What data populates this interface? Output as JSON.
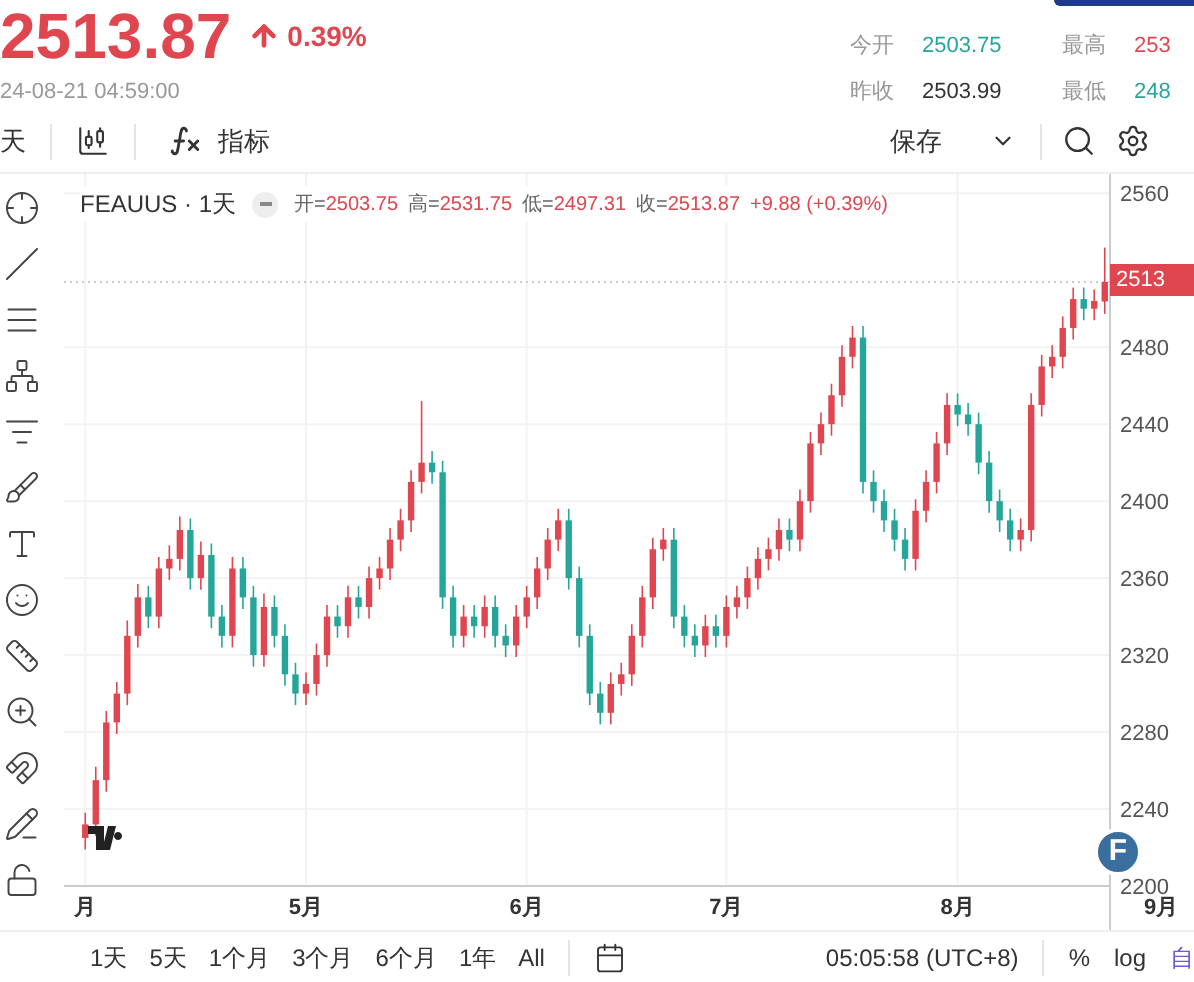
{
  "quote": {
    "price": "2513.87",
    "change": "0.39%",
    "timestamp": "24-08-21 04:59:00"
  },
  "stats": [
    {
      "label": "今开",
      "value": "2503.75",
      "color": "#26a69a"
    },
    {
      "label": "昨收",
      "value": "2503.99",
      "color": "#333333"
    },
    {
      "label": "最高",
      "value": "253",
      "color": "#e0464f"
    },
    {
      "label": "最低",
      "value": "248",
      "color": "#26a69a"
    }
  ],
  "toolbar": {
    "interval": "天",
    "indicators": "指标",
    "save": "保存"
  },
  "legend": {
    "symbol": "FEAUUS · 1天",
    "values": [
      {
        "label": "开=",
        "value": "2503.75"
      },
      {
        "label": "高=",
        "value": "2531.75"
      },
      {
        "label": "低=",
        "value": "2497.31"
      },
      {
        "label": "收=",
        "value": "2513.87"
      }
    ],
    "change": "+9.88 (+0.39%)"
  },
  "chart_data": {
    "type": "candlestick",
    "categories": [
      "月",
      null,
      null,
      null,
      null,
      null,
      null,
      null,
      null,
      null,
      null,
      null,
      null,
      null,
      null,
      null,
      null,
      null,
      null,
      null,
      null,
      "5月",
      null,
      null,
      null,
      null,
      null,
      null,
      null,
      null,
      null,
      null,
      null,
      null,
      null,
      null,
      null,
      null,
      null,
      null,
      null,
      null,
      "6月",
      null,
      null,
      null,
      null,
      null,
      null,
      null,
      null,
      null,
      null,
      null,
      null,
      null,
      null,
      null,
      null,
      null,
      null,
      "7月",
      null,
      null,
      null,
      null,
      null,
      null,
      null,
      null,
      null,
      null,
      null,
      null,
      null,
      null,
      null,
      null,
      null,
      null,
      null,
      null,
      null,
      "8月",
      null,
      null,
      null,
      null,
      null,
      null,
      null,
      null,
      null,
      null,
      null,
      null,
      null,
      null
    ],
    "ohlc": [
      [
        2225,
        2238,
        2219,
        2232
      ],
      [
        2232,
        2262,
        2226,
        2255
      ],
      [
        2255,
        2291,
        2249,
        2285
      ],
      [
        2285,
        2306,
        2279,
        2300
      ],
      [
        2300,
        2338,
        2294,
        2330
      ],
      [
        2330,
        2357,
        2324,
        2350
      ],
      [
        2350,
        2356,
        2334,
        2340
      ],
      [
        2340,
        2371,
        2334,
        2365
      ],
      [
        2365,
        2377,
        2359,
        2370
      ],
      [
        2370,
        2392,
        2364,
        2385
      ],
      [
        2385,
        2391,
        2354,
        2360
      ],
      [
        2360,
        2379,
        2354,
        2372
      ],
      [
        2372,
        2378,
        2334,
        2340
      ],
      [
        2340,
        2346,
        2324,
        2330
      ],
      [
        2330,
        2371,
        2324,
        2365
      ],
      [
        2365,
        2371,
        2344,
        2350
      ],
      [
        2350,
        2356,
        2314,
        2320
      ],
      [
        2320,
        2352,
        2314,
        2345
      ],
      [
        2345,
        2351,
        2324,
        2330
      ],
      [
        2330,
        2336,
        2304,
        2310
      ],
      [
        2310,
        2316,
        2294,
        2300
      ],
      [
        2300,
        2311,
        2294,
        2305
      ],
      [
        2305,
        2326,
        2299,
        2320
      ],
      [
        2320,
        2346,
        2314,
        2340
      ],
      [
        2340,
        2346,
        2329,
        2335
      ],
      [
        2335,
        2356,
        2329,
        2350
      ],
      [
        2350,
        2356,
        2339,
        2345
      ],
      [
        2345,
        2366,
        2339,
        2360
      ],
      [
        2360,
        2371,
        2354,
        2365
      ],
      [
        2365,
        2386,
        2359,
        2380
      ],
      [
        2380,
        2396,
        2374,
        2390
      ],
      [
        2390,
        2416,
        2384,
        2410
      ],
      [
        2410,
        2452,
        2404,
        2420
      ],
      [
        2420,
        2426,
        2409,
        2415
      ],
      [
        2415,
        2421,
        2344,
        2350
      ],
      [
        2350,
        2356,
        2324,
        2330
      ],
      [
        2330,
        2346,
        2324,
        2340
      ],
      [
        2340,
        2346,
        2329,
        2335
      ],
      [
        2335,
        2351,
        2329,
        2345
      ],
      [
        2345,
        2351,
        2324,
        2330
      ],
      [
        2330,
        2336,
        2319,
        2325
      ],
      [
        2325,
        2346,
        2319,
        2340
      ],
      [
        2340,
        2356,
        2334,
        2350
      ],
      [
        2350,
        2371,
        2344,
        2365
      ],
      [
        2365,
        2386,
        2359,
        2380
      ],
      [
        2380,
        2396,
        2374,
        2390
      ],
      [
        2390,
        2396,
        2354,
        2360
      ],
      [
        2360,
        2366,
        2324,
        2330
      ],
      [
        2330,
        2336,
        2294,
        2300
      ],
      [
        2300,
        2306,
        2284,
        2290
      ],
      [
        2290,
        2311,
        2284,
        2305
      ],
      [
        2305,
        2316,
        2299,
        2310
      ],
      [
        2310,
        2336,
        2304,
        2330
      ],
      [
        2330,
        2356,
        2324,
        2350
      ],
      [
        2350,
        2381,
        2344,
        2375
      ],
      [
        2375,
        2386,
        2369,
        2380
      ],
      [
        2380,
        2386,
        2334,
        2340
      ],
      [
        2340,
        2346,
        2324,
        2330
      ],
      [
        2330,
        2336,
        2319,
        2325
      ],
      [
        2325,
        2341,
        2319,
        2335
      ],
      [
        2335,
        2341,
        2324,
        2330
      ],
      [
        2330,
        2351,
        2324,
        2345
      ],
      [
        2345,
        2356,
        2339,
        2350
      ],
      [
        2350,
        2366,
        2344,
        2360
      ],
      [
        2360,
        2376,
        2354,
        2370
      ],
      [
        2370,
        2381,
        2364,
        2375
      ],
      [
        2375,
        2391,
        2369,
        2385
      ],
      [
        2385,
        2391,
        2374,
        2380
      ],
      [
        2380,
        2406,
        2374,
        2400
      ],
      [
        2400,
        2436,
        2394,
        2430
      ],
      [
        2430,
        2446,
        2424,
        2440
      ],
      [
        2440,
        2461,
        2434,
        2455
      ],
      [
        2455,
        2481,
        2449,
        2475
      ],
      [
        2475,
        2491,
        2469,
        2485
      ],
      [
        2485,
        2491,
        2404,
        2410
      ],
      [
        2410,
        2416,
        2394,
        2400
      ],
      [
        2400,
        2406,
        2384,
        2390
      ],
      [
        2390,
        2396,
        2374,
        2380
      ],
      [
        2380,
        2386,
        2364,
        2370
      ],
      [
        2370,
        2401,
        2364,
        2395
      ],
      [
        2395,
        2416,
        2389,
        2410
      ],
      [
        2410,
        2436,
        2404,
        2430
      ],
      [
        2430,
        2456,
        2424,
        2450
      ],
      [
        2450,
        2456,
        2439,
        2445
      ],
      [
        2445,
        2451,
        2434,
        2440
      ],
      [
        2440,
        2446,
        2414,
        2420
      ],
      [
        2420,
        2426,
        2394,
        2400
      ],
      [
        2400,
        2406,
        2384,
        2390
      ],
      [
        2390,
        2396,
        2374,
        2380
      ],
      [
        2380,
        2391,
        2374,
        2385
      ],
      [
        2385,
        2456,
        2379,
        2450
      ],
      [
        2450,
        2476,
        2444,
        2470
      ],
      [
        2470,
        2481,
        2464,
        2475
      ],
      [
        2475,
        2496,
        2469,
        2490
      ],
      [
        2490,
        2511,
        2484,
        2505
      ],
      [
        2505,
        2511,
        2494,
        2500
      ],
      [
        2500,
        2510,
        2494,
        2504
      ],
      [
        2503.75,
        2531.75,
        2497.31,
        2513.87
      ]
    ],
    "ylim": [
      2200,
      2570
    ],
    "yticks": [
      2560,
      2480,
      2440,
      2400,
      2360,
      2320,
      2280,
      2240,
      2200
    ],
    "grid": true,
    "ref_lines": [
      {
        "axis": "y",
        "value": 2513.87
      }
    ]
  },
  "time_axis_end": "9月",
  "current_price": "2513",
  "badge": "F",
  "ranges": [
    "1天",
    "5天",
    "1个月",
    "3个月",
    "6个月",
    "1年",
    "All"
  ],
  "clock": "05:05:58 (UTC+8)",
  "scale_buttons": [
    "%",
    "log",
    "自"
  ]
}
